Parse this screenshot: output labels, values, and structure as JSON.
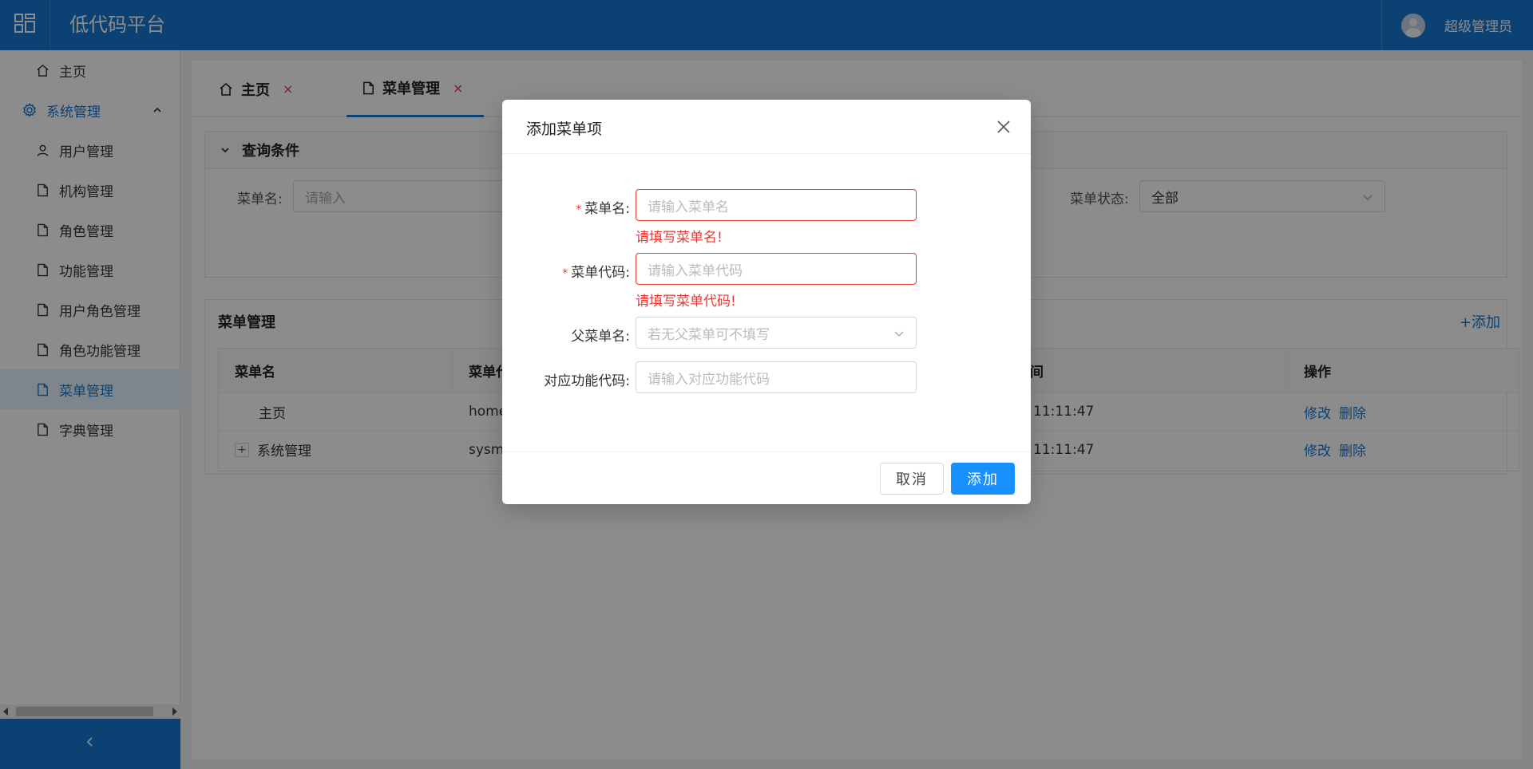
{
  "header": {
    "title": "低代码平台",
    "user_name": "超级管理员"
  },
  "sidebar": {
    "home": "主页",
    "system": "系统管理",
    "items": [
      "用户管理",
      "机构管理",
      "角色管理",
      "功能管理",
      "用户角色管理",
      "角色功能管理",
      "菜单管理",
      "字典管理"
    ],
    "active_item": "菜单管理"
  },
  "tabs": [
    {
      "label": "主页",
      "close": "×"
    },
    {
      "label": "菜单管理",
      "close": "×"
    }
  ],
  "query": {
    "title": "查询条件",
    "menu_name_label": "菜单名:",
    "menu_name_placeholder": "请输入",
    "status_label": "菜单状态:",
    "status_value": "全部"
  },
  "list": {
    "title": "菜单管理",
    "add_label": "+添加",
    "columns": [
      "菜单名",
      "菜单代码",
      "间",
      "操作"
    ],
    "rows": [
      {
        "name": "主页",
        "code": "home",
        "time": "11:11:47",
        "edit": "修改",
        "delete": "删除"
      },
      {
        "name": "系统管理",
        "code": "sysmg",
        "time": "11:11:47",
        "edit": "修改",
        "delete": "删除"
      }
    ]
  },
  "modal": {
    "title": "添加菜单项",
    "fields": [
      {
        "label": "菜单名:",
        "placeholder": "请输入菜单名",
        "required": true,
        "error": "请填写菜单名!"
      },
      {
        "label": "菜单代码:",
        "placeholder": "请输入菜单代码",
        "required": true,
        "error": "请填写菜单代码!"
      },
      {
        "label": "父菜单名:",
        "placeholder": "若无父菜单可不填写",
        "required": false
      },
      {
        "label": "对应功能代码:",
        "placeholder": "请输入对应功能代码",
        "required": false
      }
    ],
    "required_mark": "*",
    "cancel_label": "取消",
    "submit_label": "添加"
  },
  "colors": {
    "brand": "#1677d2",
    "primary_button": "#1890ff",
    "error": "#e53935"
  },
  "icons": [
    "apps-icon",
    "home-icon",
    "gear-icon",
    "user-icon",
    "file-icon",
    "chevron-up-icon",
    "chevron-down-icon",
    "chevron-left-icon",
    "close-icon",
    "plus-icon"
  ]
}
